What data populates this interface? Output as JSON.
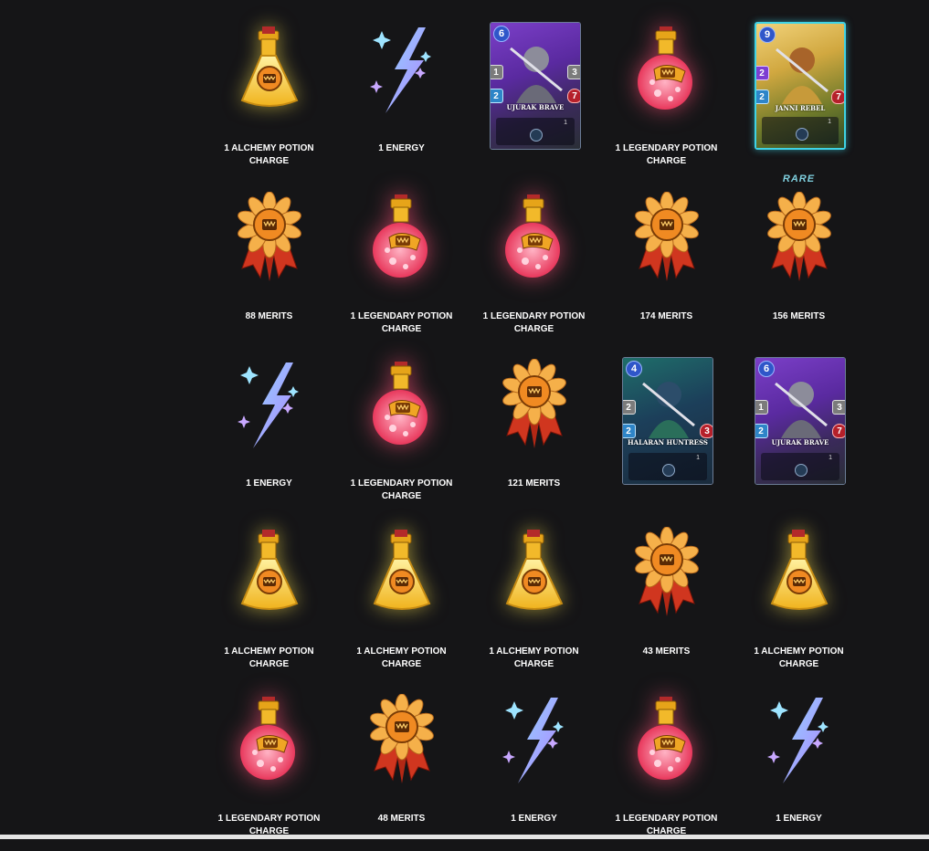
{
  "rewards": [
    {
      "type": "alchemy",
      "label": "1 ALCHEMY POTION CHARGE"
    },
    {
      "type": "energy",
      "label": "1 ENERGY"
    },
    {
      "type": "card",
      "label": "",
      "card": {
        "name": "UJURAK BRAVE",
        "mana": "6",
        "attack": "1",
        "speed": "2",
        "armor": "3",
        "health": "7",
        "level": "1",
        "theme": "purple"
      }
    },
    {
      "type": "legendary",
      "label": "1 LEGENDARY POTION CHARGE"
    },
    {
      "type": "card",
      "label": "",
      "card": {
        "name": "JANNI REBEL",
        "mana": "9",
        "attack": "2",
        "speed": "2",
        "armor": "",
        "health": "7",
        "level": "1",
        "theme": "gold",
        "rarity": "RARE"
      }
    },
    {
      "type": "merits",
      "label": "88 MERITS"
    },
    {
      "type": "legendary",
      "label": "1 LEGENDARY POTION CHARGE"
    },
    {
      "type": "legendary",
      "label": "1 LEGENDARY POTION CHARGE"
    },
    {
      "type": "merits",
      "label": "174 MERITS"
    },
    {
      "type": "merits",
      "label": "156 MERITS"
    },
    {
      "type": "energy",
      "label": "1 ENERGY"
    },
    {
      "type": "legendary",
      "label": "1 LEGENDARY POTION CHARGE"
    },
    {
      "type": "merits",
      "label": "121 MERITS"
    },
    {
      "type": "card",
      "label": "",
      "card": {
        "name": "HALARAN HUNTRESS",
        "mana": "4",
        "attack": "2",
        "speed": "2",
        "armor": "",
        "health": "3",
        "level": "1",
        "theme": "teal"
      }
    },
    {
      "type": "card",
      "label": "",
      "card": {
        "name": "UJURAK BRAVE",
        "mana": "6",
        "attack": "1",
        "speed": "2",
        "armor": "3",
        "health": "7",
        "level": "1",
        "theme": "purple"
      }
    },
    {
      "type": "alchemy",
      "label": "1 ALCHEMY POTION CHARGE"
    },
    {
      "type": "alchemy",
      "label": "1 ALCHEMY POTION CHARGE"
    },
    {
      "type": "alchemy",
      "label": "1 ALCHEMY POTION CHARGE"
    },
    {
      "type": "merits",
      "label": "43 MERITS"
    },
    {
      "type": "alchemy",
      "label": "1 ALCHEMY POTION CHARGE"
    },
    {
      "type": "legendary",
      "label": "1 LEGENDARY POTION CHARGE"
    },
    {
      "type": "merits",
      "label": "48 MERITS"
    },
    {
      "type": "energy",
      "label": "1 ENERGY"
    },
    {
      "type": "legendary",
      "label": "1 LEGENDARY POTION CHARGE"
    },
    {
      "type": "energy",
      "label": "1 ENERGY"
    }
  ],
  "colors": {
    "background": "#151517",
    "gold": "#f2c230",
    "legendary_pink": "#ff5a7a",
    "energy_blue": "#8fb8ff",
    "merit_orange": "#f08a22",
    "rare_cyan": "#3fd3e6"
  }
}
